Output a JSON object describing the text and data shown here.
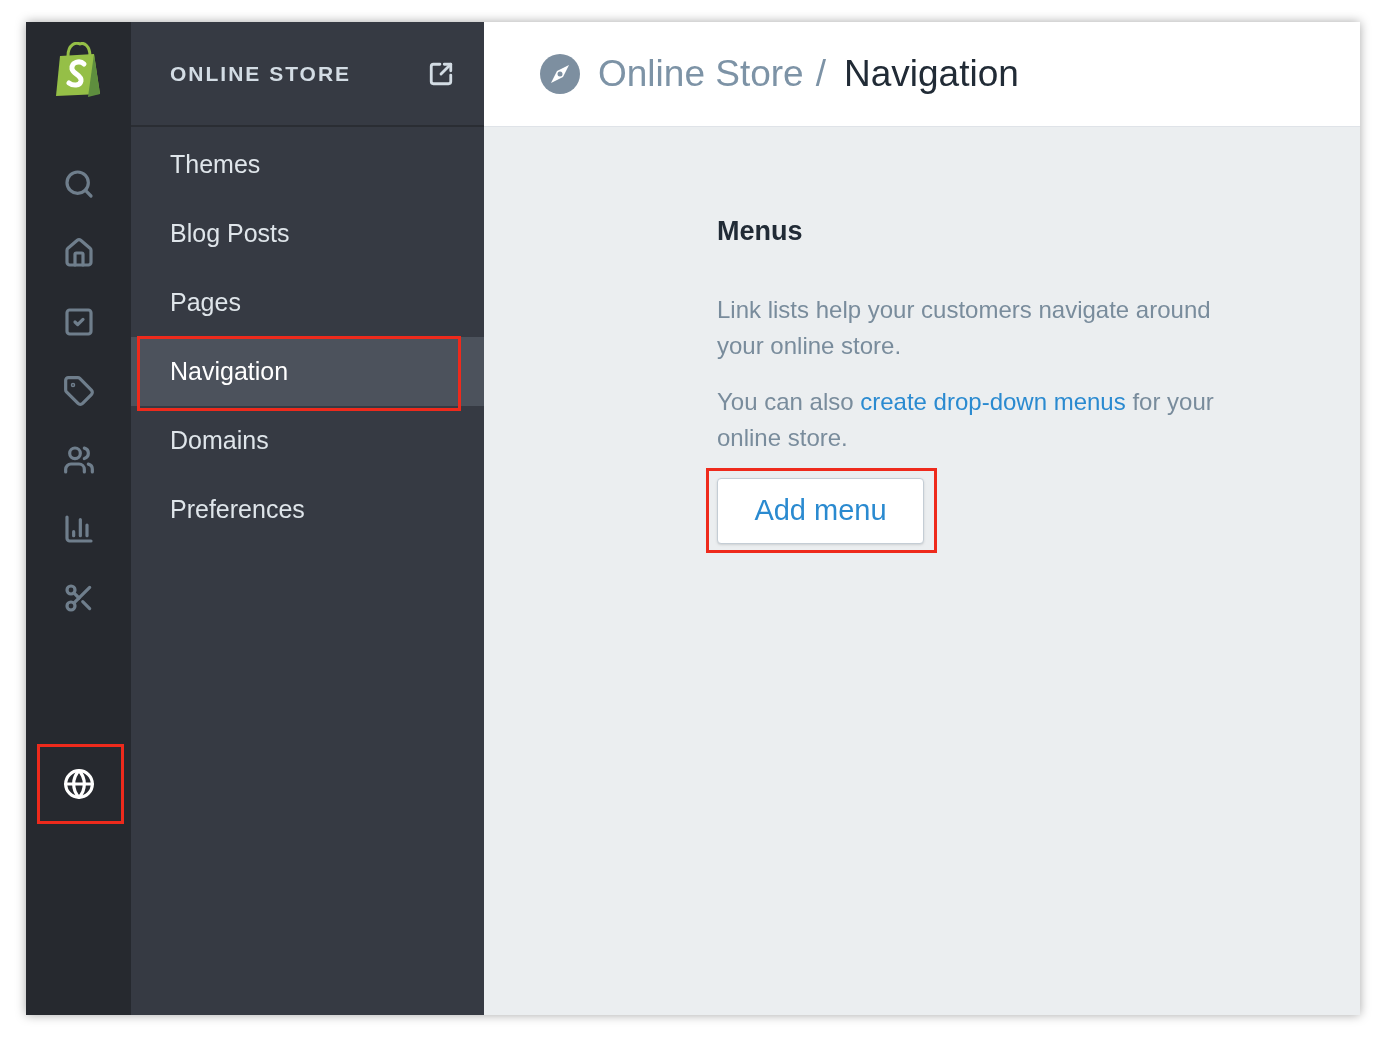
{
  "rail": [
    {
      "selected": false,
      "highlighted": false
    },
    {
      "selected": false,
      "highlighted": false
    },
    {
      "selected": false,
      "highlighted": false
    },
    {
      "selected": false,
      "highlighted": false
    },
    {
      "selected": false,
      "highlighted": false
    },
    {
      "selected": false,
      "highlighted": false
    },
    {
      "selected": false,
      "highlighted": false
    },
    {
      "selected": true,
      "highlighted": true
    }
  ],
  "sidebar": {
    "title": "ONLINE STORE",
    "items": [
      {
        "label": "Themes",
        "selected": false,
        "highlighted": false
      },
      {
        "label": "Blog Posts",
        "selected": false,
        "highlighted": false
      },
      {
        "label": "Pages",
        "selected": false,
        "highlighted": false
      },
      {
        "label": "Navigation",
        "selected": true,
        "highlighted": true
      },
      {
        "label": "Domains",
        "selected": false,
        "highlighted": false
      },
      {
        "label": "Preferences",
        "selected": false,
        "highlighted": false
      }
    ]
  },
  "breadcrumb": {
    "parent": "Online Store",
    "separator": "/",
    "current": "Navigation"
  },
  "section": {
    "title": "Menus",
    "intro": "Link lists help your customers navigate around your online store.",
    "note": {
      "before": "You can also",
      "link": "create drop-down menus",
      "after": "for your online store."
    },
    "button": {
      "label": "Add menu",
      "highlighted": true
    }
  }
}
